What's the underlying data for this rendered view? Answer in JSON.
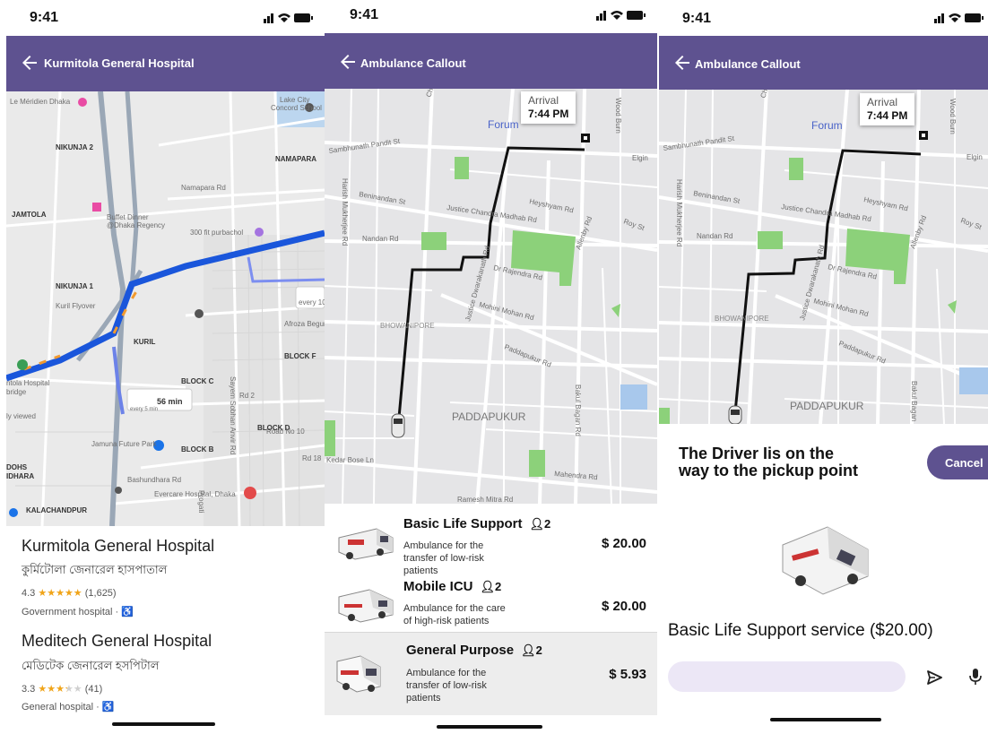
{
  "status_bar": {
    "time": "9:41"
  },
  "screen1": {
    "app_bar_title": "Kurmitola General Hospital",
    "map_labels": {
      "meridien": "Le Méridien Dhaka",
      "lake_city": "Lake City",
      "concord": "Concord School",
      "nikunja2": "NIKUNJA 2",
      "namapara": "NAMAPARA",
      "namapara_road": "Namapara Rd",
      "jamtola": "JAMTOLA",
      "hotel": "Buffet Dinner",
      "hotel2": "@Dhaka Regency",
      "purbachol": "300 fit purbachol",
      "nikunja1": "NIKUNJA 1",
      "kuril_flyover": "Kuril Flyover",
      "kuril": "KURIL",
      "afroza": "Afroza Begum",
      "every10": "every 10 r",
      "block_f": "BLOCK F",
      "block_c": "BLOCK C",
      "block_d": "BLOCK D",
      "block_b": "BLOCK B",
      "hospital_bridge": "ntola Hospital",
      "bridge": "bridge",
      "viewed": "ly viewed",
      "transit_time": "56 min",
      "transit_every": "every 5 min",
      "jamuna": "Jamuna Future Park",
      "dohs": "DOHS",
      "idhara": "IDHARA",
      "bashundhara": "Bashundhara Rd",
      "evercare": "Evercare Hospital, Dhaka",
      "kalachandpur": "KALACHANDPUR",
      "road10": "Road No 10",
      "rd18": "Rd 18",
      "rd2": "Rd 2",
      "sayem": "Sayem Sobhan Anvir Rd",
      "pragati": "Progati"
    },
    "places": [
      {
        "name": "Kurmitola General Hospital",
        "local_name": "কুর্মিটোলা জেনারেল হাসপাতাল",
        "rating": "4.3",
        "stars": "★★★★★",
        "reviews": "(1,625)",
        "type": "Government hospital · "
      },
      {
        "name": "Meditech General Hospital",
        "local_name": "মেডিটেক জেনারেল হসপিটাল",
        "rating": "3.3",
        "stars": "★★★★★",
        "reviews": "(41)",
        "type": "General hospital · "
      }
    ]
  },
  "screen2": {
    "app_bar_title": "Ambulance Callout",
    "arrival_label": "Arrival",
    "arrival_time": "7:44 PM",
    "map_labels": {
      "sambhunath": "Sambhunath Pandit St",
      "chowringhee": "Chowringhee",
      "forum": "Forum",
      "wood": "Wood Burn",
      "elgin": "Elgin",
      "beninandan": "Beninandan St",
      "heyshyam": "Heyshyam Rd",
      "justice": "Justice Chandra Madhab Rd",
      "harish": "Harish Mukherjee Rd",
      "nandan": "Nandan Rd",
      "allenby": "Allenby Rd",
      "roy": "Roy St",
      "rajendra": "Dr Rajendra Rd",
      "dwarakanath": "Justice Dwarakanath Rd",
      "bhowanipore": "BHOWANIPORE",
      "mohini": "Mohini Mohan Rd",
      "paddapukur_rd": "Paddapukur Rd",
      "bakul": "Bakul Bagan Rd",
      "paddapukur": "PADDAPUKUR",
      "kedar": "Kedar Bose Ln",
      "mahendra": "Mahendra Rd",
      "ramesh": "Ramesh Mitra Rd"
    },
    "services": [
      {
        "name": "Basic Life Support",
        "capacity": "2",
        "description": "Ambulance for the transfer of low-risk patients",
        "price": "$ 20.00"
      },
      {
        "name": "Mobile ICU",
        "capacity": "2",
        "description": "Ambulance for the care of high-risk patients",
        "price": "$ 20.00"
      },
      {
        "name": "General Purpose",
        "capacity": "2",
        "description": "Ambulance for the transfer of low-risk patients",
        "price": "$ 5.93"
      }
    ]
  },
  "screen3": {
    "app_bar_title": "Ambulance Callout",
    "arrival_label": "Arrival",
    "arrival_time": "7:44 PM",
    "driver_message": "The Driver Iis on the way to the pickup point",
    "cancel_label": "Cancel",
    "service_summary": "Basic Life Support service ($20.00)",
    "chat_placeholder": ""
  },
  "colors": {
    "primary": "#5e5290",
    "route_blue": "#1a56db",
    "map_bg": "#e5e5e7",
    "park": "#8cd17a"
  }
}
